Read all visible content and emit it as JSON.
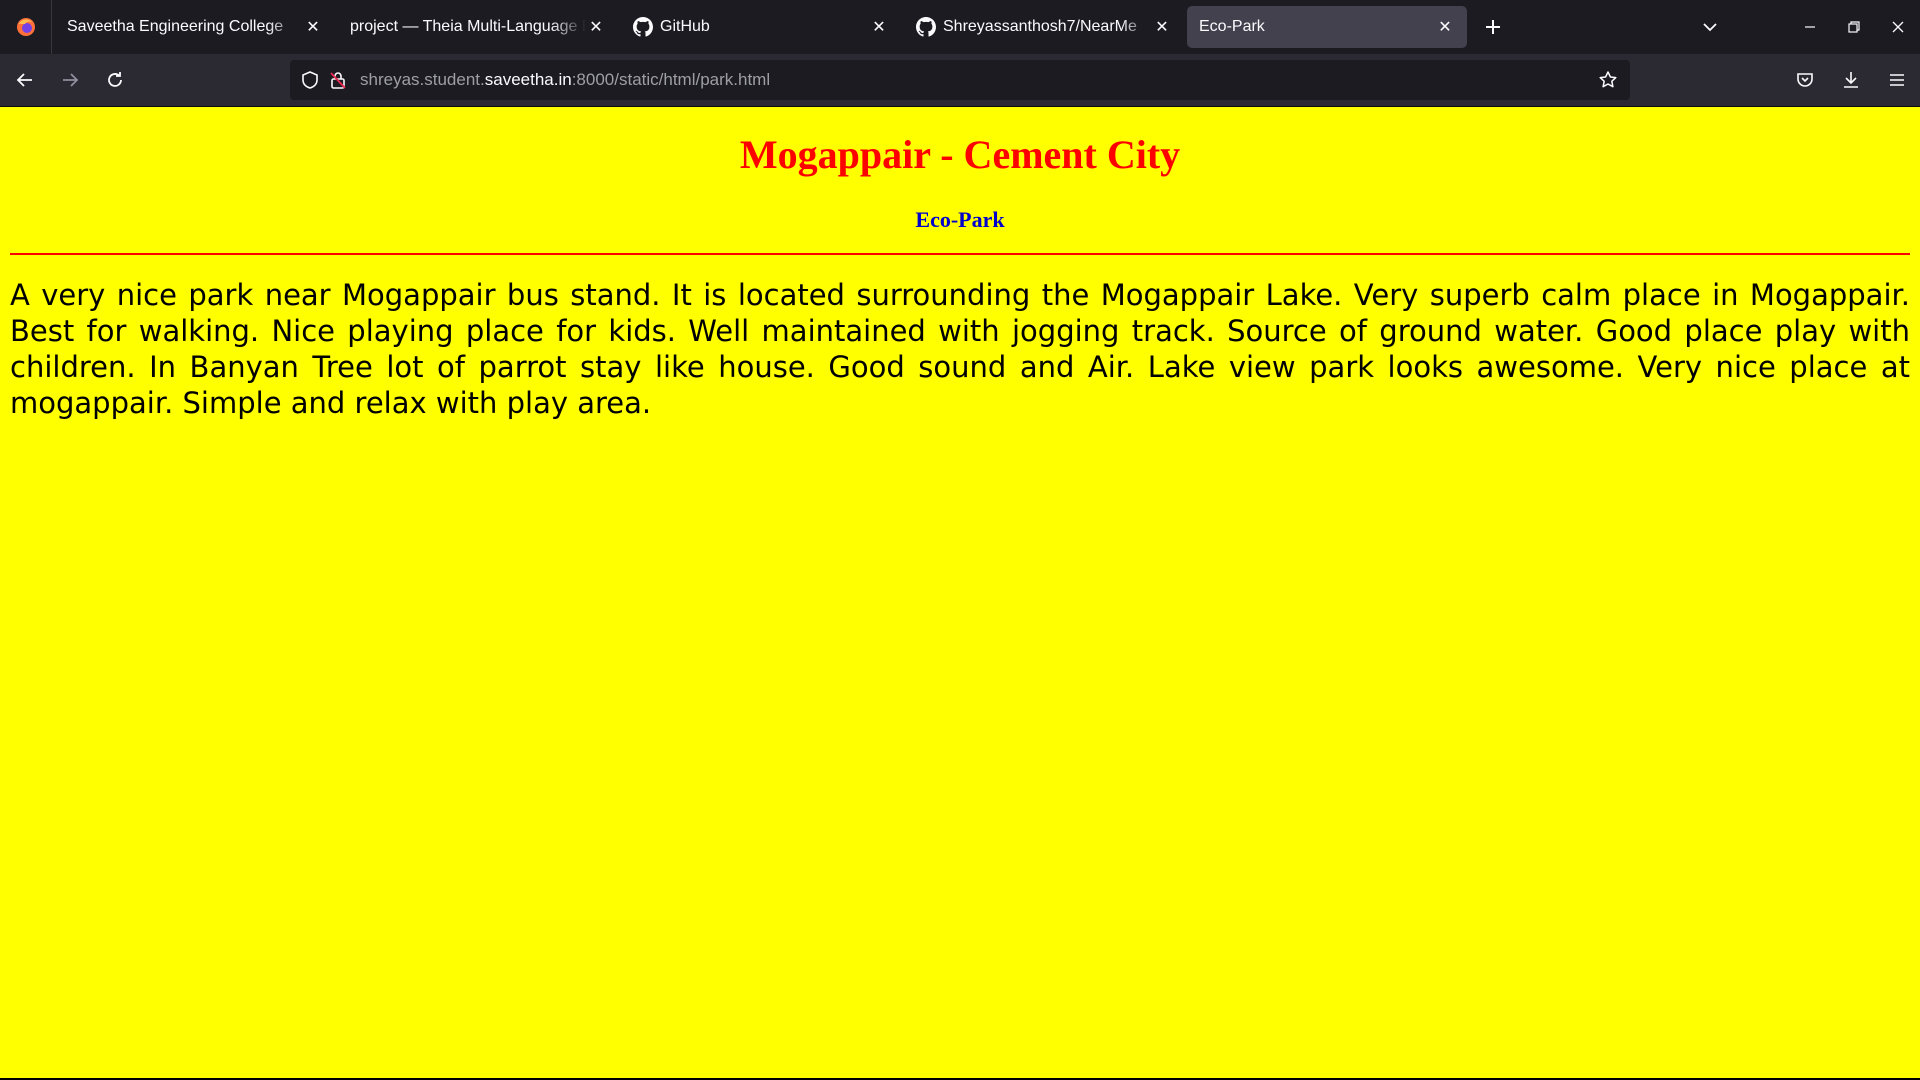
{
  "browser": {
    "tabs": [
      {
        "title": "Saveetha Engineering College",
        "icon": "none",
        "active": false
      },
      {
        "title": "project — Theia Multi-Language Example",
        "icon": "none",
        "active": false
      },
      {
        "title": "GitHub",
        "icon": "github-icon",
        "active": false
      },
      {
        "title": "Shreyassanthosh7/NearMe",
        "icon": "github-icon",
        "active": false
      },
      {
        "title": "Eco-Park",
        "icon": "none",
        "active": true
      }
    ],
    "url": {
      "prefix": "shreyas.student.",
      "host": "saveetha.in",
      "path": ":8000/static/html/park.html"
    }
  },
  "page": {
    "title": "Mogappair - Cement City",
    "subtitle": "Eco-Park",
    "body": "A very nice park near Mogappair bus stand. It is located surrounding the Mogappair Lake. Very superb calm place in Mogappair. Best for walking. Nice playing place for kids. Well maintained with jogging track. Source of ground water. Good place play with children. In Banyan Tree lot of parrot stay like house. Good sound and Air. Lake view park looks awesome. Very nice place at mogappair. Simple and relax with play area."
  },
  "colors": {
    "page_background": "#ffff00",
    "title": "#ff0000",
    "subtitle": "#0000cc",
    "rule": "#ff0000",
    "chrome_dark": "#1c1b22",
    "chrome_toolbar": "#2b2a33"
  }
}
